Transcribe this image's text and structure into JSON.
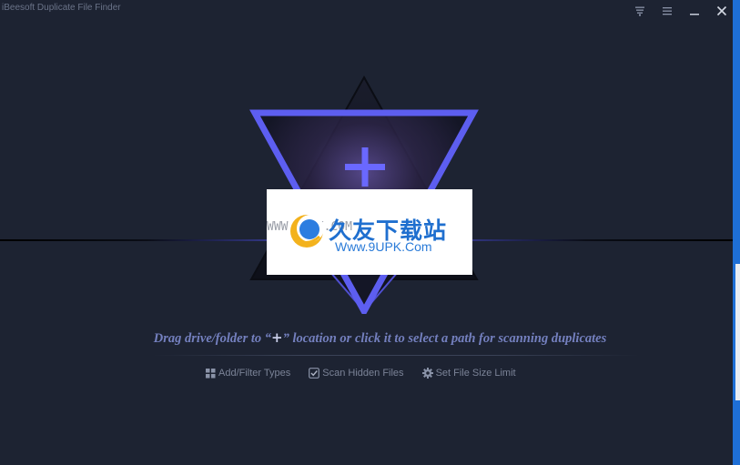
{
  "window": {
    "title": "iBeesoft Duplicate File Finder"
  },
  "controls": {
    "feedback_icon": "feedback-icon",
    "menu_icon": "menu-icon",
    "minimize_icon": "minimize-icon",
    "close_icon": "close-icon"
  },
  "main": {
    "instruction_before": "Drag drive/folder to “",
    "instruction_plus": "+",
    "instruction_after": "” location or click it to select a path for scanning duplicates",
    "options": [
      {
        "label": "Add/Filter Types",
        "icon": "grid-icon"
      },
      {
        "label": "Scan Hidden Files",
        "icon": "checkbox-icon",
        "checked": true
      },
      {
        "label": "Set File Size Limit",
        "icon": "gear-icon"
      }
    ]
  },
  "watermark": {
    "brand": "久友下载站",
    "url": "Www.9UPK.Com",
    "faint_url": "WWW.9UPK.COM"
  },
  "colors": {
    "background": "#1d2332",
    "accent": "#5d5ef0",
    "text_muted": "#7480bf"
  }
}
